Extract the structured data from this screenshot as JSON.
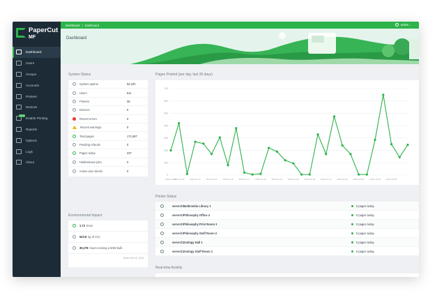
{
  "brand": {
    "name": "PaperCut",
    "product": "MF"
  },
  "topbar": {
    "crumb_1": "Dashboard",
    "crumb_2": "Dashboard",
    "user": "admin ⌄"
  },
  "page_title": "Dashboard",
  "sidebar": {
    "items": [
      {
        "label": "Dashboard",
        "icon": "chart-icon",
        "active": true
      },
      {
        "label": "Users",
        "icon": "user-icon"
      },
      {
        "label": "Groups",
        "icon": "group-icon"
      },
      {
        "label": "Accounts",
        "icon": "account-icon"
      },
      {
        "label": "Printers",
        "icon": "printer-icon"
      },
      {
        "label": "Devices",
        "icon": "device-icon"
      },
      {
        "label": "Enable Printing",
        "icon": "enable-printing-icon",
        "badge": "NEW"
      },
      {
        "label": "Reports",
        "icon": "report-icon"
      },
      {
        "label": "Options",
        "icon": "options-icon"
      },
      {
        "label": "Logs",
        "icon": "logs-icon"
      },
      {
        "label": "About",
        "icon": "about-icon"
      }
    ]
  },
  "system_status": {
    "title": "System Status",
    "rows": [
      {
        "label": "System uptime",
        "value": "5d 22h",
        "icon": "clock-icon"
      },
      {
        "label": "Users",
        "value": "611",
        "icon": "user-icon"
      },
      {
        "label": "Printers",
        "value": "36",
        "icon": "printer-icon"
      },
      {
        "label": "Devices",
        "value": "6",
        "icon": "device-icon"
      },
      {
        "label": "Recent errors",
        "value": "0",
        "icon": "error-icon"
      },
      {
        "label": "Recent warnings",
        "value": "0",
        "icon": "warning-icon"
      },
      {
        "label": "Total pages",
        "value": "171,597",
        "icon": "pages-icon"
      },
      {
        "label": "Pending refunds",
        "value": "0",
        "icon": "refund-icon"
      },
      {
        "label": "Pages today",
        "value": "237",
        "icon": "pages-today-icon"
      },
      {
        "label": "Held/release jobs",
        "value": "0",
        "icon": "held-jobs-icon"
      },
      {
        "label": "Active user clients",
        "value": "0",
        "icon": "client-icon"
      }
    ]
  },
  "environmental": {
    "title": "Environmental Impact",
    "trees": "1.72",
    "trees_label": "trees",
    "co2": "523.8",
    "co2_label": "kg of CO₂",
    "hours": "39,278",
    "hours_label": "hours running a 60W bulb",
    "footer": "Since Feb 16, 2018"
  },
  "chart_title": "Pages Printed (per day, last 30 days)",
  "chart_data": {
    "type": "line",
    "color": "#2db34a",
    "x": [
      "2019-11-08",
      "2019-11-09",
      "2019-11-10",
      "2019-11-11",
      "2019-11-12",
      "2019-11-13",
      "2019-11-14",
      "2019-11-15",
      "2019-11-16",
      "2019-11-17",
      "2019-11-18",
      "2019-11-19",
      "2019-11-20",
      "2019-11-21",
      "2019-11-22",
      "2019-11-23",
      "2019-11-24",
      "2019-11-25",
      "2019-11-26",
      "2019-11-27",
      "2019-11-28",
      "2019-11-29",
      "2019-11-30",
      "2019-12-01",
      "2019-12-02",
      "2019-12-03",
      "2019-12-04",
      "2019-12-05",
      "2019-12-06",
      "2019-12-07"
    ],
    "values": [
      200,
      420,
      10,
      270,
      255,
      170,
      305,
      80,
      380,
      20,
      5,
      10,
      220,
      190,
      120,
      95,
      5,
      5,
      330,
      170,
      475,
      240,
      170,
      5,
      5,
      285,
      650,
      250,
      145,
      245
    ],
    "ylim": [
      0,
      700
    ],
    "yticks": [
      0,
      100,
      200,
      300,
      400,
      500,
      600,
      700
    ],
    "xtick_labels": [
      "2019-11-08",
      "2019-11-09",
      "2019-11-11",
      "2019-11-13",
      "2019-11-15",
      "2019-11-17",
      "2019-11-19",
      "2019-11-21",
      "2019-11-23",
      "2019-11-25",
      "2019-11-27",
      "2019-11-29",
      "2019-12-01",
      "2019-12-03",
      "2019-12-05"
    ],
    "grid": true
  },
  "printer_status": {
    "title": "Printer Status",
    "rows": [
      {
        "name": "server1\\Multimedia Library 1",
        "status": "0 pages today"
      },
      {
        "name": "server1\\Philosophy Office 4",
        "status": "0 pages today"
      },
      {
        "name": "server1\\Philosophy Print Room 3",
        "status": "0 pages today"
      },
      {
        "name": "server1\\Philosophy Staff Room 2",
        "status": "0 pages today"
      },
      {
        "name": "server1\\Zoology Hall 1",
        "status": "0 pages today"
      },
      {
        "name": "server1\\Zoology Staff Room 1",
        "status": "0 pages today"
      }
    ]
  },
  "realtime_title": "Real-time Activity"
}
